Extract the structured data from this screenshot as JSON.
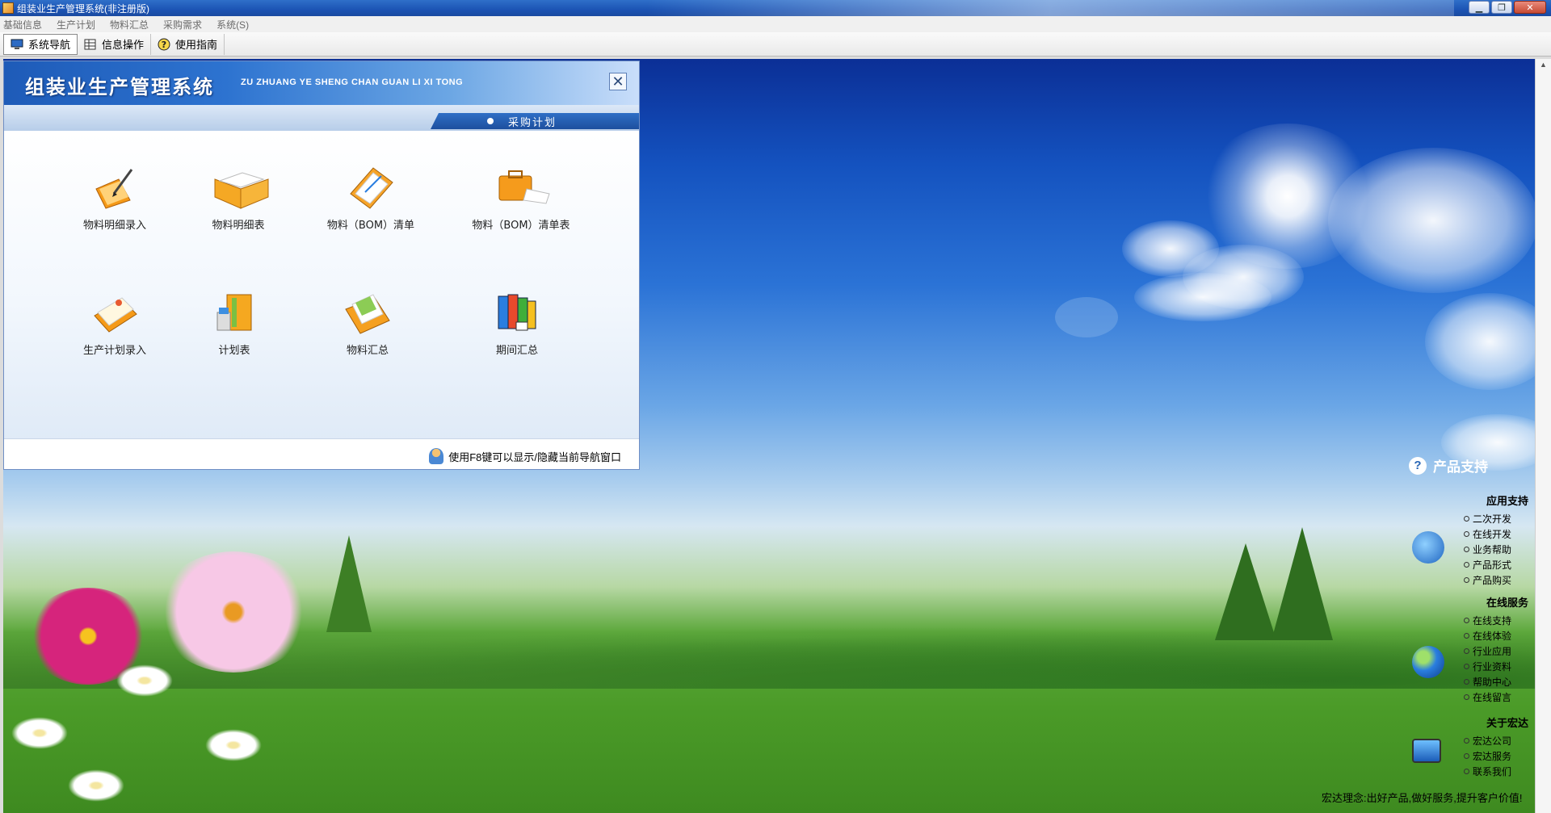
{
  "window": {
    "title": "组装业生产管理系统(非注册版)"
  },
  "menu": [
    "基础信息",
    "生产计划",
    "物料汇总",
    "采购需求",
    "系统(S)"
  ],
  "toolbar": [
    {
      "label": "系统导航",
      "icon": "monitor-icon"
    },
    {
      "label": "信息操作",
      "icon": "grid-icon"
    },
    {
      "label": "使用指南",
      "icon": "help-icon"
    }
  ],
  "nav": {
    "title_cn": "组装业生产管理系统",
    "title_en": "ZU ZHUANG YE SHENG CHAN GUAN LI XI TONG",
    "current_tab": "采购计划",
    "items": [
      {
        "label": "物料明细录入",
        "icon": "pencil-folder-icon"
      },
      {
        "label": "物料明细表",
        "icon": "open-folder-icon"
      },
      {
        "label": "物料（BOM）清单",
        "icon": "clipboard-icon"
      },
      {
        "label": "物料（BOM）清单表",
        "icon": "briefcase-icon"
      },
      {
        "label": "生产计划录入",
        "icon": "notebook-icon"
      },
      {
        "label": "计划表",
        "icon": "binder-icon"
      },
      {
        "label": "物料汇总",
        "icon": "document-folder-icon"
      },
      {
        "label": "期间汇总",
        "icon": "books-icon"
      }
    ],
    "footer_hint": "使用F8键可以显示/隐藏当前导航窗口"
  },
  "support": {
    "title": "产品支持",
    "sections": [
      {
        "title": "应用支持",
        "links": [
          "二次开发",
          "在线开发",
          "业务帮助",
          "产品形式",
          "产品购买"
        ]
      },
      {
        "title": "在线服务",
        "links": [
          "在线支持",
          "在线体验",
          "行业应用",
          "行业资料",
          "帮助中心",
          "在线留言"
        ]
      },
      {
        "title": "关于宏达",
        "links": [
          "宏达公司",
          "宏达服务",
          "联系我们"
        ]
      }
    ],
    "slogan": "宏达理念:出好产品,做好服务,提升客户价值!"
  }
}
